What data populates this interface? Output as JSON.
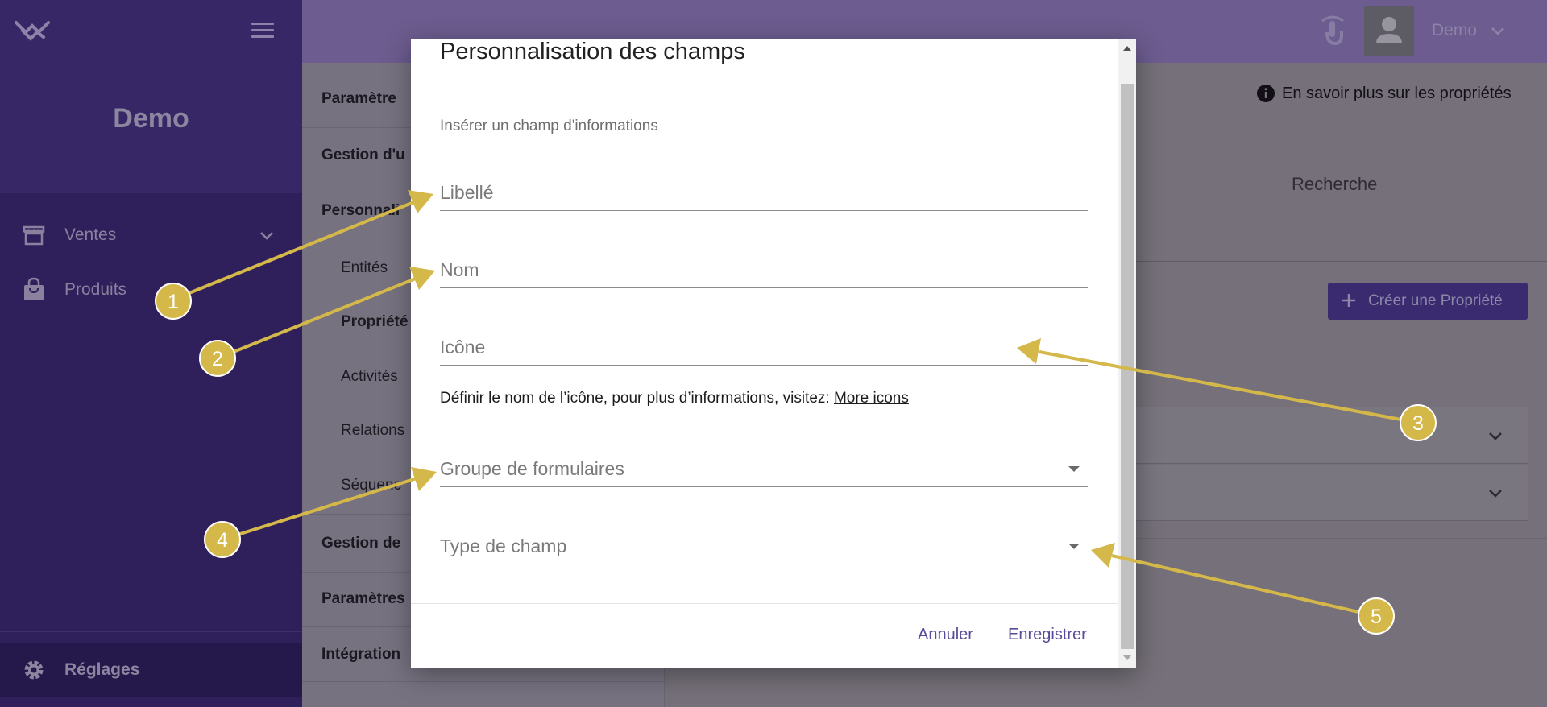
{
  "sidebar": {
    "org_name": "Demo",
    "items": [
      {
        "label": "Ventes",
        "icon": "store-icon"
      },
      {
        "label": "Produits",
        "icon": "shopping-bag-icon"
      }
    ],
    "settings_label": "Réglages"
  },
  "topbar": {
    "user_name": "Demo"
  },
  "settings_menu": {
    "items": [
      {
        "label": "Paramètre",
        "style": "bold"
      },
      {
        "label": "Gestion d'u",
        "style": "bold"
      },
      {
        "label": "Personnali",
        "style": "bold"
      },
      {
        "label": "Entités",
        "style": "sub"
      },
      {
        "label": "Propriété",
        "style": "sub-bold"
      },
      {
        "label": "Activités",
        "style": "sub"
      },
      {
        "label": "Relations",
        "style": "sub"
      },
      {
        "label": "Séquenc",
        "style": "sub"
      },
      {
        "label": "Gestion de",
        "style": "bold"
      },
      {
        "label": "Paramètres",
        "style": "bold"
      },
      {
        "label": "Intégration",
        "style": "bold"
      }
    ]
  },
  "main": {
    "info_link": "En savoir plus sur les propriétés",
    "search_placeholder": "Recherche",
    "create_button": "Créer une Propriété"
  },
  "modal": {
    "title": "Personnalisation des champs",
    "section_label": "Insérer un champ d'informations",
    "fields": {
      "label": "Libellé",
      "name": "Nom",
      "icon": "Icône",
      "form_group": "Groupe de formulaires",
      "field_type": "Type de champ"
    },
    "helper_text": "Définir le nom de l’icône, pour plus d’informations, visitez: ",
    "helper_link": "More icons",
    "cancel_label": "Annuler",
    "save_label": "Enregistrer"
  },
  "annotations": [
    "1",
    "2",
    "3",
    "4",
    "5"
  ],
  "colors": {
    "sidebar": "#2f1f5a",
    "accent": "#5a4a9a",
    "annotation": "#d4b84a"
  }
}
